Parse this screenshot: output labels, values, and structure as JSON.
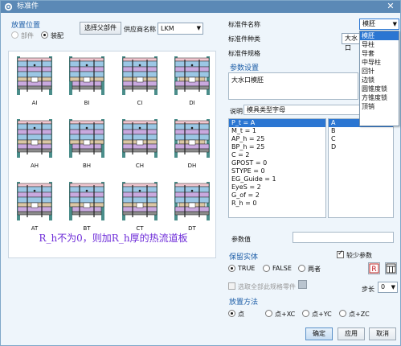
{
  "window": {
    "title": "标准件"
  },
  "placement": {
    "heading": "放置位置",
    "options": [
      {
        "label": "部件",
        "selected": false,
        "enabled": false
      },
      {
        "label": "装配",
        "selected": true,
        "enabled": true
      }
    ],
    "select_parent_button": "选择父部件",
    "supplier_label": "供应商名称",
    "supplier_value": "LKM"
  },
  "molds": [
    {
      "caption": "AI"
    },
    {
      "caption": "BI"
    },
    {
      "caption": "CI"
    },
    {
      "caption": "DI"
    },
    {
      "caption": "AH"
    },
    {
      "caption": "BH"
    },
    {
      "caption": "CH"
    },
    {
      "caption": "DH"
    },
    {
      "caption": "AT"
    },
    {
      "caption": "BT"
    },
    {
      "caption": "CT"
    },
    {
      "caption": "DT"
    }
  ],
  "mold_colors": {
    "plate_top": "#4a8d8a",
    "plate_mid": "#9bc7e5",
    "plate_purple": "#c9a9df",
    "plate_pink": "#f0c6cf",
    "plate_tan": "#dac7a4",
    "plate_gray": "#8c8c8c",
    "line": "#222222"
  },
  "hint_text": "R_h不为0，则加R_h厚的热流道板",
  "standard": {
    "name_label": "标准件名称",
    "name_value": "模胚",
    "type_label": "标准件种类",
    "type_value": "大水口",
    "spec_label": "标准件规格",
    "dropdown_options": [
      "模胚",
      "导柱",
      "导套",
      "中导柱",
      "回针",
      "边锁",
      "圆锥度锁",
      "方锥度锁",
      "顶销"
    ],
    "dropdown_selected_index": 0
  },
  "params": {
    "heading": "参数设置",
    "description": "大水口模胚",
    "explain_label": "说明",
    "explain_value": "模具类型字母",
    "items": [
      "P_t = A",
      "M_t = 1",
      "AP_h = 25",
      "BP_h = 25",
      "C = 2",
      "GPOST = 0",
      "STYPE = 0",
      "EG_Guide = 1",
      "EyeS = 2",
      "G_of = 2",
      "R_h = 0"
    ],
    "selected_index": 0,
    "values": [
      "A",
      "B",
      "C",
      "D"
    ],
    "values_selected_index": 0,
    "value_label": "参数值",
    "value_value": ""
  },
  "keep_solid": {
    "heading": "保留实体",
    "options": [
      {
        "label": "TRUE",
        "selected": true
      },
      {
        "label": "FALSE",
        "selected": false
      },
      {
        "label": "两者",
        "selected": false
      }
    ],
    "fewer_params_label": "较少参数",
    "fewer_params_checked": true
  },
  "select_all_label": "选取全部此规格零件",
  "step_label": "步长",
  "step_value": "0",
  "method": {
    "heading": "放置方法",
    "options": [
      {
        "label": "点",
        "selected": true
      },
      {
        "label": "点+XC",
        "selected": false
      },
      {
        "label": "点+YC",
        "selected": false
      },
      {
        "label": "点+ZC",
        "selected": false
      }
    ]
  },
  "buttons": {
    "ok": "确定",
    "apply": "应用",
    "cancel": "取消"
  },
  "colors": {
    "accent": "#2b76d2",
    "title_bar": "#5b89b6",
    "hint": "#6d2bd8",
    "group_heading": "#1f5fa8"
  }
}
